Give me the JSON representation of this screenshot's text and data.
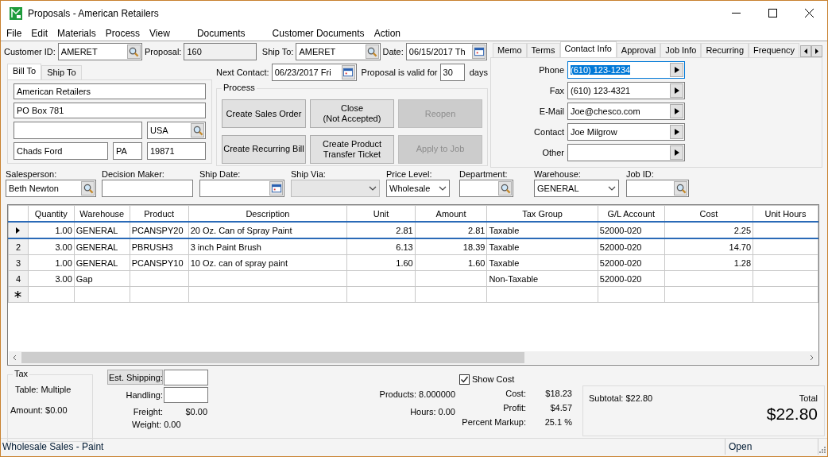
{
  "window": {
    "title": "Proposals - American Retailers"
  },
  "menu": [
    "File",
    "Edit",
    "Materials",
    "Process",
    "View",
    "Documents",
    "Customer Documents",
    "Action"
  ],
  "header": {
    "customer_id": {
      "label": "Customer ID:",
      "value": "AMERET"
    },
    "proposal": {
      "label": "Proposal:",
      "value": "160"
    },
    "ship_to": {
      "label": "Ship To:",
      "value": "AMERET"
    },
    "date": {
      "label": "Date:",
      "value": "06/15/2017 Th"
    }
  },
  "address_tabs": [
    {
      "label": "Bill To",
      "selected": true
    },
    {
      "label": "Ship To",
      "selected": false
    }
  ],
  "address": {
    "name": "American Retailers",
    "street": "PO Box 781",
    "country": "USA",
    "city": "Chads Ford",
    "state": "PA",
    "zip": "19871"
  },
  "next_contact": {
    "label": "Next Contact:",
    "value": "06/23/2017 Fri"
  },
  "validity": {
    "label": "Proposal is valid for",
    "value": "30",
    "unit": "days"
  },
  "process": {
    "title": "Process",
    "buttons": [
      {
        "label": "Create Sales Order",
        "disabled": false
      },
      {
        "label": "Close\n(Not Accepted)",
        "disabled": false
      },
      {
        "label": "Reopen",
        "disabled": true
      },
      {
        "label": "Create Recurring Bill",
        "disabled": false
      },
      {
        "label": "Create Product\nTransfer Ticket",
        "disabled": false
      },
      {
        "label": "Apply to Job",
        "disabled": true
      }
    ]
  },
  "info_tabs": [
    {
      "label": "Memo",
      "selected": false
    },
    {
      "label": "Terms",
      "selected": false
    },
    {
      "label": "Contact Info",
      "selected": true
    },
    {
      "label": "Approval",
      "selected": false
    },
    {
      "label": "Job Info",
      "selected": false
    },
    {
      "label": "Recurring",
      "selected": false
    },
    {
      "label": "Frequency",
      "selected": false
    }
  ],
  "contact": [
    {
      "label": "Phone",
      "value": "(610) 123-1234",
      "selected": true
    },
    {
      "label": "Fax",
      "value": "(610) 123-4321",
      "selected": false
    },
    {
      "label": "E-Mail",
      "value": "Joe@chesco.com",
      "selected": false
    },
    {
      "label": "Contact",
      "value": "Joe Milgrow",
      "selected": false
    },
    {
      "label": "Other",
      "selected": false
    }
  ],
  "fields": [
    {
      "label": "Salesperson:",
      "value": "Beth Newton",
      "kind": "lookup"
    },
    {
      "label": "Decision Maker:",
      "kind": "text"
    },
    {
      "label": "Ship Date:",
      "kind": "date"
    },
    {
      "label": "Ship Via:",
      "kind": "dropdown",
      "disabled": true
    },
    {
      "label": "Price Level:",
      "value": "Wholesale",
      "kind": "dropdown",
      "disabled": false
    },
    {
      "label": "Department:",
      "kind": "lookup"
    },
    {
      "label": "Warehouse:",
      "value": "GENERAL",
      "kind": "dropdown",
      "disabled": false
    },
    {
      "label": "Job ID:",
      "kind": "lookup"
    }
  ],
  "table": {
    "columns": [
      {
        "label": "Quantity",
        "numeric": true
      },
      {
        "label": "Warehouse",
        "numeric": false
      },
      {
        "label": "Product",
        "numeric": false
      },
      {
        "label": "Description",
        "numeric": false
      },
      {
        "label": "Unit",
        "numeric": true
      },
      {
        "label": "Amount",
        "numeric": true
      },
      {
        "label": "Tax Group",
        "numeric": false
      },
      {
        "label": "G/L Account",
        "numeric": false
      },
      {
        "label": "Cost",
        "numeric": true
      },
      {
        "label": "Unit Hours",
        "numeric": true
      }
    ],
    "rows": [
      {
        "selected": true,
        "cells": [
          "1.00",
          "GENERAL",
          "PCANSPY20",
          "20 Oz. Can of Spray Paint",
          "2.81",
          "2.81",
          "Taxable",
          "52000-020",
          "2.25",
          null
        ]
      },
      {
        "header": "2",
        "selected": false,
        "cells": [
          "3.00",
          "GENERAL",
          "PBRUSH3",
          "3 inch Paint Brush",
          "6.13",
          "18.39",
          "Taxable",
          "52000-020",
          "14.70",
          null
        ]
      },
      {
        "header": "3",
        "selected": false,
        "cells": [
          "1.00",
          "GENERAL",
          "PCANSPY10",
          "10 Oz. can of spray paint",
          "1.60",
          "1.60",
          "Taxable",
          "52000-020",
          "1.28",
          null
        ]
      },
      {
        "header": "4",
        "selected": false,
        "cells": [
          "3.00",
          "Gap",
          null,
          null,
          null,
          null,
          "Non-Taxable",
          "52000-020",
          null,
          null
        ]
      }
    ],
    "new_row": true
  },
  "tax": {
    "title": "Tax",
    "table": "Table: Multiple",
    "amount": "Amount: $0.00"
  },
  "shipping": {
    "button": "Est. Shipping:",
    "handling": "Handling:",
    "freight_label": "Freight:",
    "freight": "$0.00",
    "weight": "Weight: 0.00"
  },
  "totals": {
    "products": "Products: 8.000000",
    "hours": "Hours: 0.00",
    "show_cost": {
      "label": "Show Cost",
      "checked": true
    },
    "lines": [
      {
        "label": "Cost:",
        "value": "$18.23"
      },
      {
        "label": "Profit:",
        "value": "$4.57"
      },
      {
        "label": "Percent Markup:",
        "value": "25.1 %"
      }
    ]
  },
  "summary": {
    "subtotal": "Subtotal: $22.80",
    "total_label": "Total",
    "total": "$22.80"
  },
  "status_bar": [
    "Wholesale Sales - Paint",
    "Open"
  ]
}
